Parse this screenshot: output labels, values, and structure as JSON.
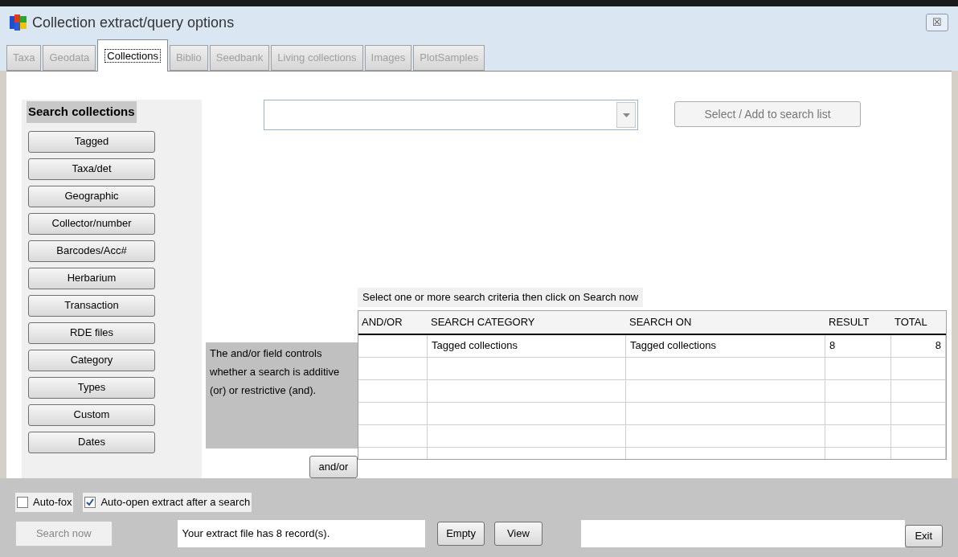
{
  "window": {
    "title": "Collection extract/query options",
    "close": "☒"
  },
  "tabs": [
    {
      "label": "Taxa",
      "selected": false
    },
    {
      "label": "Geodata",
      "selected": false
    },
    {
      "label": "Collections",
      "selected": true
    },
    {
      "label": "Biblio",
      "selected": false
    },
    {
      "label": "Seedbank",
      "selected": false
    },
    {
      "label": "Living collections",
      "selected": false
    },
    {
      "label": "Images",
      "selected": false
    },
    {
      "label": "PlotSamples",
      "selected": false
    }
  ],
  "sidebar": {
    "title": "Search collections",
    "buttons": [
      "Tagged",
      "Taxa/det",
      "Geographic",
      "Collector/number",
      "Barcodes/Acc#",
      "Herbarium",
      "Transaction",
      "RDE files",
      "Category",
      "Types",
      "Custom",
      "Dates"
    ]
  },
  "add_button": {
    "label": "Select / Add to search list",
    "disabled": true
  },
  "hint": "The and/or field controls whether a search is additive (or) or restrictive (and).",
  "andor_button": "and/or",
  "instruction": "Select one or more search criteria then click on Search now",
  "table": {
    "columns": [
      "AND/OR",
      "SEARCH CATEGORY",
      "SEARCH ON",
      "RESULT",
      "TOTAL"
    ],
    "rows": [
      [
        "",
        "Tagged collections",
        "Tagged collections",
        "8",
        "8"
      ]
    ]
  },
  "options": [
    {
      "label": "Auto-fox",
      "checked": false
    },
    {
      "label": "Auto-open extract after a search",
      "checked": true
    }
  ],
  "search_button": {
    "label": "Search now",
    "disabled": true
  },
  "status": "Your extract file has 8 record(s).",
  "empty_button": "Empty",
  "view_button": "View",
  "exit_button": "Exit"
}
